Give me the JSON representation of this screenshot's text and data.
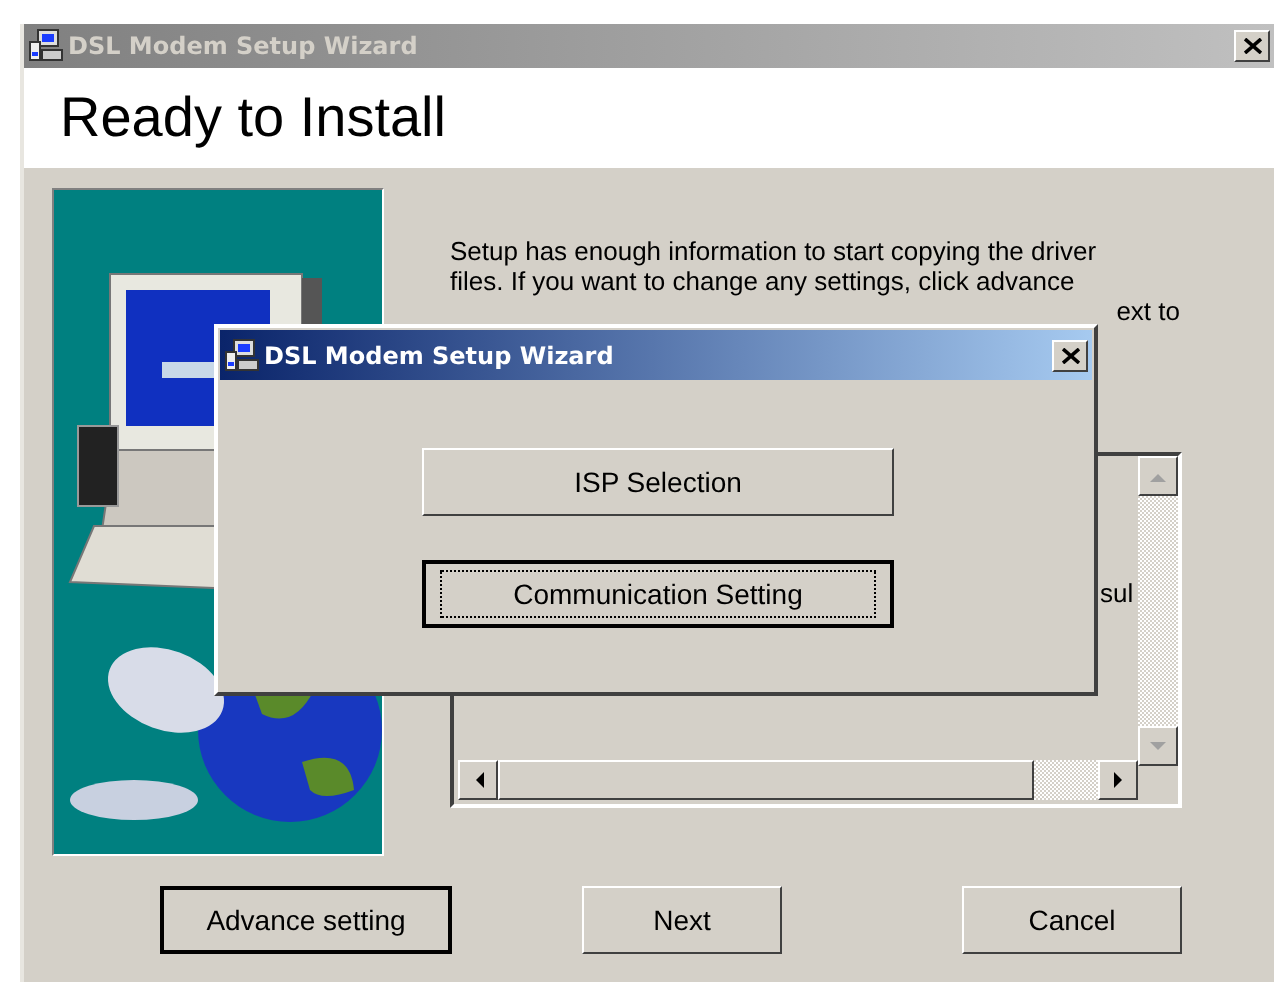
{
  "window": {
    "title": "DSL Modem Setup Wizard",
    "active": false
  },
  "header": {
    "title": "Ready to Install"
  },
  "intro_lines": [
    "Setup has enough information to start copying the driver",
    "files. If you want to change any settings, click advance",
    "ext to"
  ],
  "details_box": {
    "text": "sul"
  },
  "buttons": [
    {
      "label": "Advance setting",
      "default": true
    },
    {
      "label": "Next",
      "default": false
    },
    {
      "label": "Cancel",
      "default": false
    }
  ],
  "dialog": {
    "title": "DSL Modem Setup Wizard",
    "active": true,
    "buttons": [
      {
        "label": "ISP Selection",
        "focused": false
      },
      {
        "label": "Communication Setting",
        "focused": true
      }
    ]
  }
}
